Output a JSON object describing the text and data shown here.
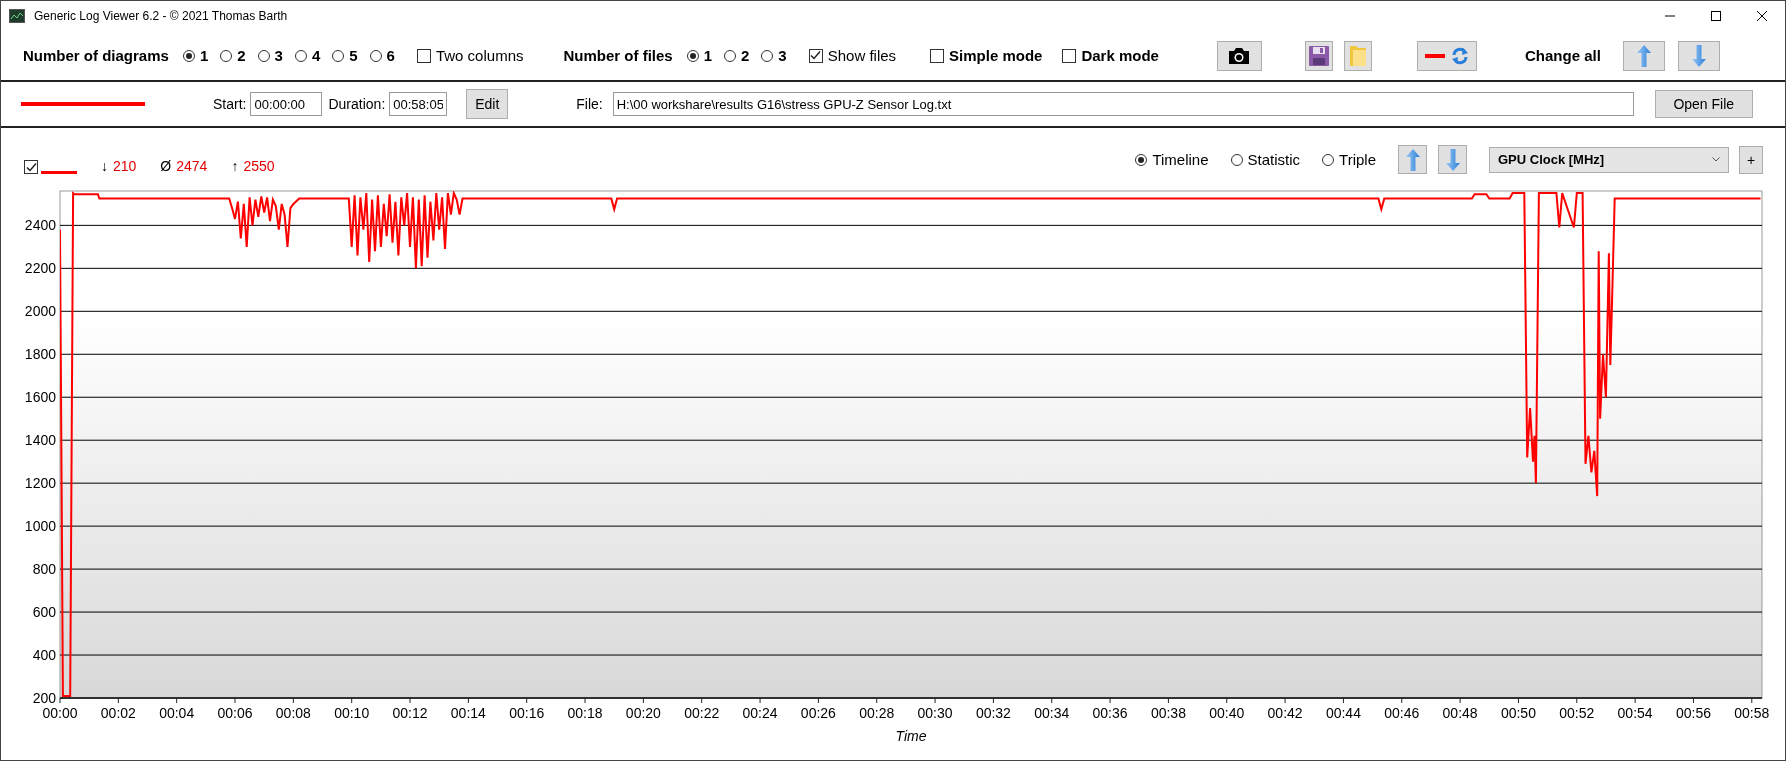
{
  "window": {
    "title": "Generic Log Viewer 6.2 - © 2021 Thomas Barth"
  },
  "toolbar": {
    "diagrams_label": "Number of diagrams",
    "diagram_options": [
      {
        "label": "1",
        "selected": true
      },
      {
        "label": "2",
        "selected": false
      },
      {
        "label": "3",
        "selected": false
      },
      {
        "label": "4",
        "selected": false
      },
      {
        "label": "5",
        "selected": false
      },
      {
        "label": "6",
        "selected": false
      }
    ],
    "two_columns": {
      "label": "Two columns",
      "checked": false
    },
    "files_label": "Number of files",
    "file_options": [
      {
        "label": "1",
        "selected": true
      },
      {
        "label": "2",
        "selected": false
      },
      {
        "label": "3",
        "selected": false
      }
    ],
    "show_files": {
      "label": "Show files",
      "checked": true
    },
    "simple_mode": {
      "label": "Simple mode",
      "checked": false
    },
    "dark_mode": {
      "label": "Dark mode",
      "checked": false
    },
    "change_all_label": "Change all"
  },
  "file_bar": {
    "start_label": "Start:",
    "start": "00:00:00",
    "duration_label": "Duration:",
    "duration": "00:58:05",
    "edit_button": "Edit",
    "file_label": "File:",
    "file_path": "H:\\00 workshare\\results G16\\stress GPU-Z Sensor Log.txt",
    "open_button": "Open File"
  },
  "diagram": {
    "visible": true,
    "stats": [
      {
        "symbol": "↓",
        "value": "210"
      },
      {
        "symbol": "Ø",
        "value": "2474"
      },
      {
        "symbol": "↑",
        "value": "2550"
      }
    ],
    "views": [
      {
        "label": "Timeline",
        "selected": true
      },
      {
        "label": "Statistic",
        "selected": false
      },
      {
        "label": "Triple",
        "selected": false
      }
    ],
    "sensor": "GPU Clock [MHz]",
    "add_button": "+",
    "chart_data": {
      "type": "line",
      "grid": true,
      "xlabel": "Time",
      "x": [
        0,
        0.1,
        0.15,
        0.35,
        0.45,
        0.5,
        1.3,
        1.35,
        5.8,
        5.9,
        6.0,
        6.1,
        6.2,
        6.3,
        6.4,
        6.5,
        6.6,
        6.7,
        6.8,
        6.9,
        7.0,
        7.1,
        7.2,
        7.3,
        7.4,
        7.5,
        7.6,
        7.7,
        7.8,
        7.9,
        8.0,
        8.2,
        9.9,
        10.0,
        10.1,
        10.2,
        10.3,
        10.4,
        10.5,
        10.6,
        10.7,
        10.8,
        10.9,
        11.0,
        11.1,
        11.2,
        11.3,
        11.4,
        11.5,
        11.6,
        11.7,
        11.8,
        11.9,
        12.0,
        12.1,
        12.2,
        12.3,
        12.4,
        12.5,
        12.6,
        12.7,
        12.8,
        12.9,
        13.0,
        13.1,
        13.2,
        13.3,
        13.4,
        13.5,
        13.6,
        13.7,
        13.8,
        18.9,
        19.0,
        19.1,
        45.2,
        45.3,
        45.4,
        48.4,
        48.5,
        48.9,
        49.0,
        49.7,
        49.8,
        50.2,
        50.3,
        50.4,
        50.5,
        50.55,
        50.6,
        50.7,
        50.75,
        51.3,
        51.4,
        51.5,
        51.9,
        52.0,
        52.2,
        52.3,
        52.4,
        52.5,
        52.6,
        52.7,
        52.75,
        52.8,
        52.9,
        53.0,
        53.1,
        53.15,
        53.2,
        53.3,
        58.3
      ],
      "series": [
        {
          "color": "#ff0000",
          "values": [
            2380,
            210,
            210,
            210,
            2550,
            2545,
            2545,
            2525,
            2525,
            2480,
            2430,
            2510,
            2340,
            2500,
            2300,
            2530,
            2400,
            2520,
            2440,
            2535,
            2460,
            2530,
            2420,
            2520,
            2490,
            2380,
            2500,
            2450,
            2300,
            2480,
            2500,
            2525,
            2525,
            2300,
            2540,
            2260,
            2530,
            2380,
            2550,
            2230,
            2520,
            2280,
            2540,
            2300,
            2500,
            2350,
            2545,
            2320,
            2510,
            2260,
            2530,
            2400,
            2550,
            2300,
            2530,
            2200,
            2520,
            2210,
            2540,
            2250,
            2510,
            2330,
            2550,
            2380,
            2530,
            2290,
            2550,
            2450,
            2550,
            2520,
            2450,
            2525,
            2525,
            2475,
            2525,
            2525,
            2475,
            2525,
            2525,
            2545,
            2545,
            2525,
            2525,
            2550,
            2550,
            1320,
            1550,
            1300,
            1420,
            1200,
            2550,
            2550,
            2550,
            2390,
            2550,
            2390,
            2550,
            2550,
            1290,
            1420,
            1250,
            1350,
            1140,
            2280,
            1500,
            1800,
            1600,
            2270,
            1750,
            2000,
            2525,
            2525
          ]
        }
      ],
      "xlim": [
        0,
        58.35
      ],
      "ylim": [
        200,
        2560
      ],
      "xticks": [
        {
          "value": 0,
          "label": "00:00"
        },
        {
          "value": 2,
          "label": "00:02"
        },
        {
          "value": 4,
          "label": "00:04"
        },
        {
          "value": 6,
          "label": "00:06"
        },
        {
          "value": 8,
          "label": "00:08"
        },
        {
          "value": 10,
          "label": "00:10"
        },
        {
          "value": 12,
          "label": "00:12"
        },
        {
          "value": 14,
          "label": "00:14"
        },
        {
          "value": 16,
          "label": "00:16"
        },
        {
          "value": 18,
          "label": "00:18"
        },
        {
          "value": 20,
          "label": "00:20"
        },
        {
          "value": 22,
          "label": "00:22"
        },
        {
          "value": 24,
          "label": "00:24"
        },
        {
          "value": 26,
          "label": "00:26"
        },
        {
          "value": 28,
          "label": "00:28"
        },
        {
          "value": 30,
          "label": "00:30"
        },
        {
          "value": 32,
          "label": "00:32"
        },
        {
          "value": 34,
          "label": "00:34"
        },
        {
          "value": 36,
          "label": "00:36"
        },
        {
          "value": 38,
          "label": "00:38"
        },
        {
          "value": 40,
          "label": "00:40"
        },
        {
          "value": 42,
          "label": "00:42"
        },
        {
          "value": 44,
          "label": "00:44"
        },
        {
          "value": 46,
          "label": "00:46"
        },
        {
          "value": 48,
          "label": "00:48"
        },
        {
          "value": 50,
          "label": "00:50"
        },
        {
          "value": 52,
          "label": "00:52"
        },
        {
          "value": 54,
          "label": "00:54"
        },
        {
          "value": 56,
          "label": "00:56"
        },
        {
          "value": 58,
          "label": "00:58"
        }
      ],
      "yticks": [
        200,
        400,
        600,
        800,
        1000,
        1200,
        1400,
        1600,
        1800,
        2000,
        2200,
        2400
      ]
    }
  }
}
